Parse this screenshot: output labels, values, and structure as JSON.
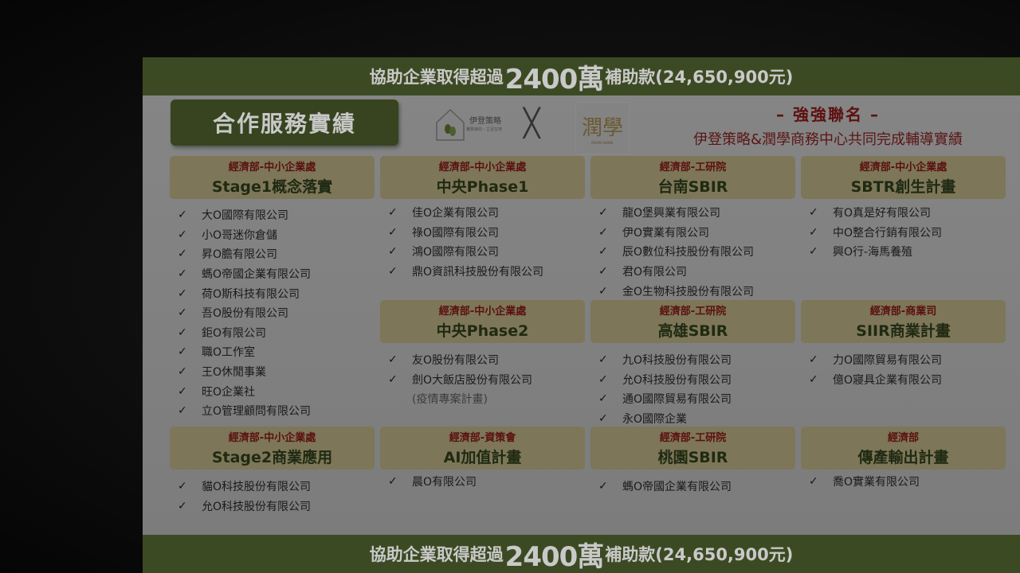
{
  "banner": {
    "prefix": "協助企業取得超過",
    "amount": "2400萬",
    "suffix": "補助款(24,650,900元)"
  },
  "title": "合作服務實績",
  "logos": {
    "yiden_text": "伊登策略",
    "yiden_sub": "實務導向・立足在地",
    "times": "╳",
    "runxue_text": "潤學",
    "runxue_sub": "ROOM SHARE"
  },
  "union": {
    "line1": "– 強強聯名 –",
    "line2": "伊登策略&潤學商務中心共同完成輔導實績"
  },
  "check_icon": "✓",
  "programs": [
    {
      "dept": "經濟部-中小企業處",
      "name": "Stage1概念落實",
      "companies": [
        "大O國際有限公司",
        "小O哥迷你倉儲",
        "昇O膽有限公司",
        "螞O帝國企業有限公司",
        "荷O斯科技有限公司",
        "吾O股份有限公司",
        "鉅O有限公司",
        "職O工作室",
        "王O休閒事業",
        "旺O企業社",
        "立O管理顧問有限公司"
      ]
    },
    {
      "dept": "經濟部-中小企業處",
      "name": "中央Phase1",
      "companies": [
        "佳O企業有限公司",
        "祿O國際有限公司",
        "鴻O國際有限公司",
        "鼎O資訊科技股份有限公司"
      ]
    },
    {
      "dept": "經濟部-工研院",
      "name": "台南SBIR",
      "companies": [
        "龍O堡興業有限公司",
        "伊O實業有限公司",
        "辰O數位科技股份有限公司",
        "君O有限公司",
        "金O生物科技股份有限公司"
      ]
    },
    {
      "dept": "經濟部-中小企業處",
      "name": "SBTR創生計畫",
      "companies": [
        "有O真是好有限公司",
        "中O整合行銷有限公司",
        "興O行-海馬養殖"
      ]
    },
    {
      "dept": "經濟部-中小企業處",
      "name": "中央Phase2",
      "companies": [
        "友O股份有限公司",
        "劍O大飯店股份有限公司"
      ],
      "note": "(疫情專案計畫)"
    },
    {
      "dept": "經濟部-工研院",
      "name": "高雄SBIR",
      "companies": [
        "九O科技股份有限公司",
        "允O科技股份有限公司",
        "通O國際貿易有限公司",
        "永O國際企業"
      ]
    },
    {
      "dept": "經濟部-商業司",
      "name": "SIIR商業計畫",
      "companies": [
        "力O國際貿易有限公司",
        "億O寢具企業有限公司"
      ]
    },
    {
      "dept": "經濟部-中小企業處",
      "name": "Stage2商業應用",
      "companies": [
        "貓O科技股份有限公司",
        "允O科技股份有限公司"
      ]
    },
    {
      "dept": "經濟部-資策會",
      "name": "AI加值計畫",
      "companies": [
        "晨O有限公司"
      ]
    },
    {
      "dept": "經濟部-工研院",
      "name": "桃園SBIR",
      "companies": [
        "螞O帝國企業有限公司"
      ]
    },
    {
      "dept": "經濟部",
      "name": "傳產輸出計畫",
      "companies": [
        "喬O實業有限公司"
      ]
    }
  ]
}
